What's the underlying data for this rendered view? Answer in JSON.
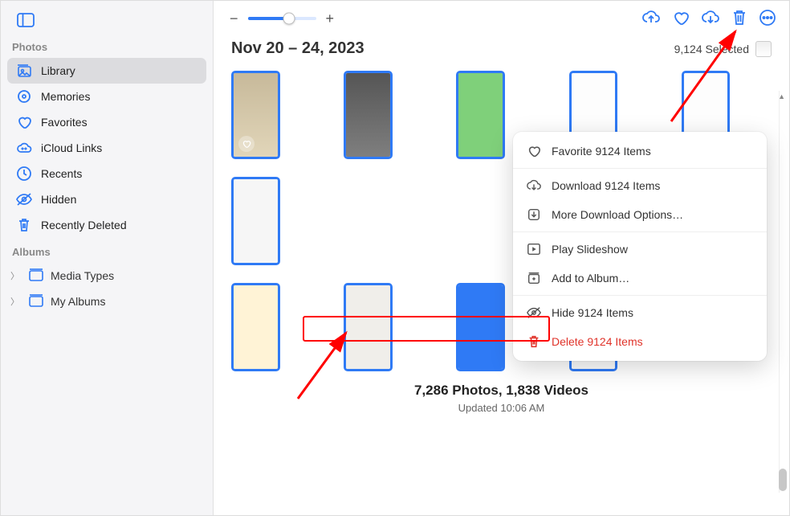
{
  "sidebar": {
    "sections": {
      "photos_title": "Photos",
      "albums_title": "Albums"
    },
    "items": [
      {
        "label": "Library"
      },
      {
        "label": "Memories"
      },
      {
        "label": "Favorites"
      },
      {
        "label": "iCloud Links"
      },
      {
        "label": "Recents"
      },
      {
        "label": "Hidden"
      },
      {
        "label": "Recently Deleted"
      }
    ],
    "albums": [
      {
        "label": "Media Types"
      },
      {
        "label": "My Albums"
      }
    ]
  },
  "header": {
    "date_range": "Nov 20 – 24, 2023",
    "selected_text": "9,124 Selected"
  },
  "toolbar": {
    "zoom_minus": "−",
    "zoom_plus": "+"
  },
  "menu": {
    "favorite": "Favorite 9124 Items",
    "download": "Download 9124 Items",
    "more_download": "More Download Options…",
    "play_slideshow": "Play Slideshow",
    "add_to_album": "Add to Album…",
    "hide": "Hide 9124 Items",
    "delete": "Delete 9124 Items"
  },
  "footer": {
    "counts": "7,286 Photos, 1,838 Videos",
    "updated": "Updated 10:06 AM"
  },
  "colors": {
    "accent": "#2f7af5",
    "danger": "#e0332a"
  }
}
